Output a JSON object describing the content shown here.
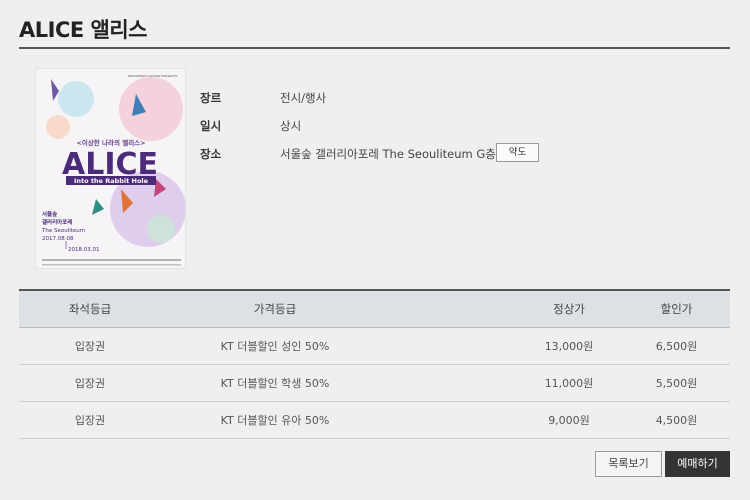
{
  "page": {
    "title": "ALICE 앨리스"
  },
  "poster": {
    "small_top": "DREAMMART CENTER PRESENTS",
    "subtitle": "<이상한 나라의 앨리스>",
    "logo": "ALICE",
    "tagline": "Into the Rabbit Hole",
    "venue_ko_1": "서울숲",
    "venue_ko_2": "갤러리아포레",
    "venue_en": "The Seouliteum",
    "date_start": "2017.08.08",
    "date_end": "2018.03.01"
  },
  "info": {
    "rows": [
      {
        "label": "장르",
        "value": "전시/행사"
      },
      {
        "label": "일시",
        "value": "상시"
      },
      {
        "label": "장소",
        "value": "서울숲 갤러리아포레 The Seouliteum G층 (B2)"
      }
    ],
    "map_button": "약도"
  },
  "table": {
    "headers": [
      "좌석등급",
      "가격등급",
      "정상가",
      "할인가"
    ],
    "rows": [
      [
        "입장권",
        "KT 더블할인 성인 50%",
        "13,000원",
        "6,500원"
      ],
      [
        "입장권",
        "KT 더블할인 학생 50%",
        "11,000원",
        "5,500원"
      ],
      [
        "입장권",
        "KT 더블할인 유아 50%",
        "9,000원",
        "4,500원"
      ]
    ]
  },
  "buttons": {
    "list": "목록보기",
    "book": "예매하기"
  }
}
